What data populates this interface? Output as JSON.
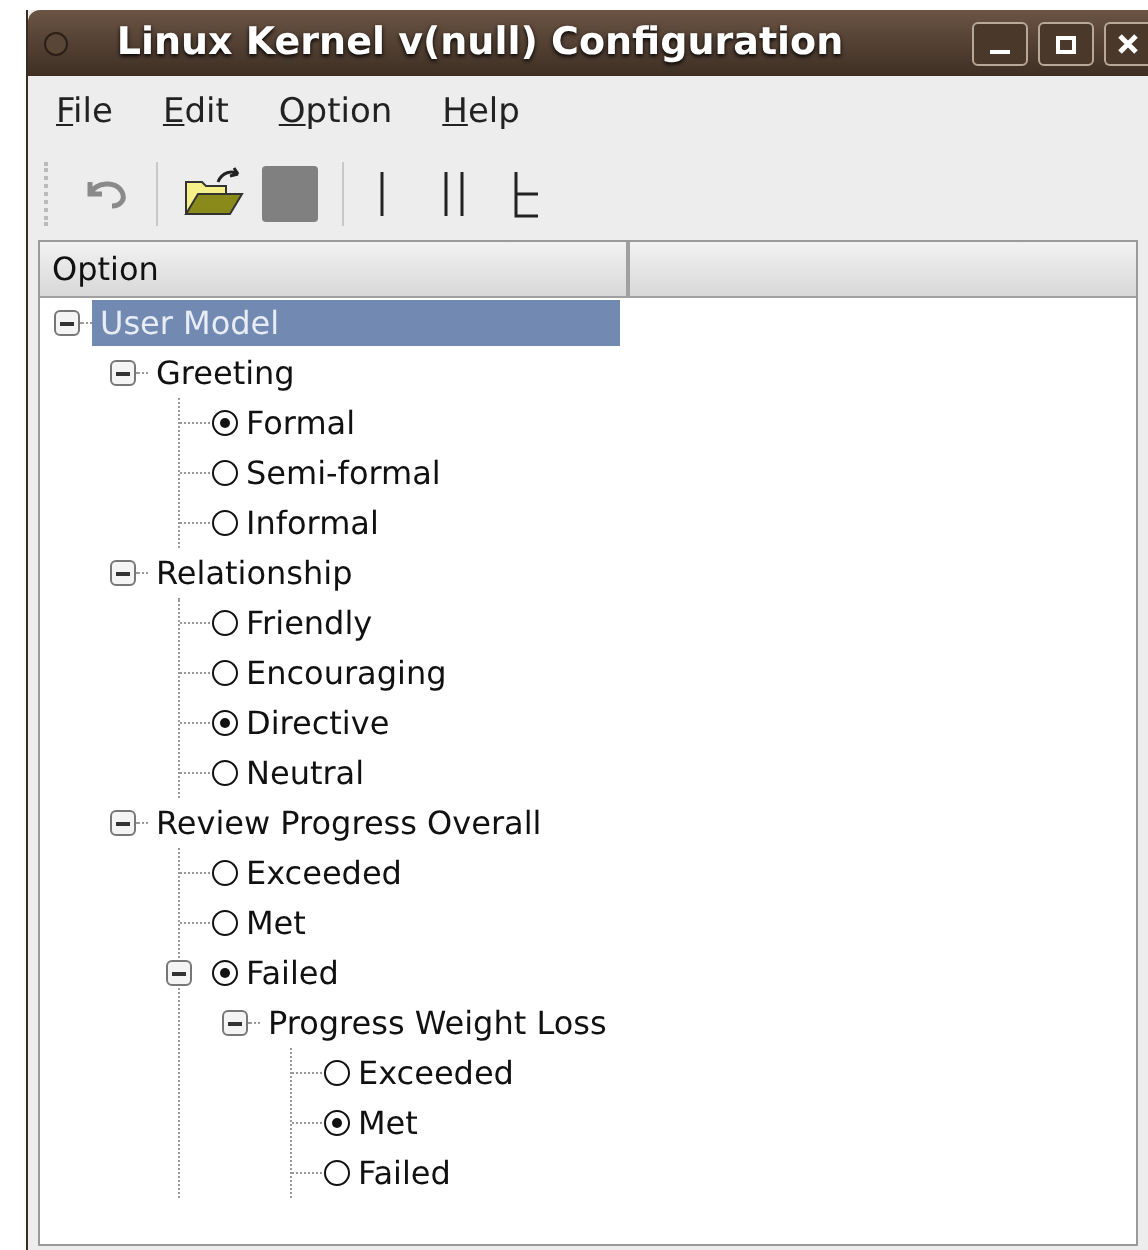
{
  "window": {
    "title": "Linux Kernel v(null) Configuration"
  },
  "menu": [
    "File",
    "Edit",
    "Option",
    "Help"
  ],
  "table": {
    "columns": [
      "Option"
    ]
  },
  "tree": [
    {
      "kind": "group",
      "label": "User Model",
      "selected": true,
      "expanded": true,
      "children": [
        {
          "kind": "group",
          "label": "Greeting",
          "selected": false,
          "expanded": true,
          "children": [
            {
              "kind": "option",
              "label": "Formal",
              "selected": false,
              "checked": true
            },
            {
              "kind": "option",
              "label": "Semi-formal",
              "selected": false,
              "checked": false
            },
            {
              "kind": "option",
              "label": "Informal",
              "selected": false,
              "checked": false
            }
          ]
        },
        {
          "kind": "group",
          "label": "Relationship",
          "selected": false,
          "expanded": true,
          "children": [
            {
              "kind": "option",
              "label": "Friendly",
              "selected": false,
              "checked": false
            },
            {
              "kind": "option",
              "label": "Encouraging",
              "selected": false,
              "checked": false
            },
            {
              "kind": "option",
              "label": "Directive",
              "selected": false,
              "checked": true
            },
            {
              "kind": "option",
              "label": "Neutral",
              "selected": false,
              "checked": false
            }
          ]
        },
        {
          "kind": "group",
          "label": "Review Progress Overall",
          "selected": false,
          "expanded": true,
          "children": [
            {
              "kind": "option",
              "label": "Exceeded",
              "selected": false,
              "checked": false
            },
            {
              "kind": "option",
              "label": "Met",
              "selected": false,
              "checked": false
            },
            {
              "kind": "option",
              "label": "Failed",
              "selected": false,
              "checked": true,
              "expanded": true,
              "children": [
                {
                  "kind": "group",
                  "label": "Progress Weight Loss",
                  "selected": false,
                  "expanded": true,
                  "children": [
                    {
                      "kind": "option",
                      "label": "Exceeded",
                      "selected": false,
                      "checked": false
                    },
                    {
                      "kind": "option",
                      "label": "Met",
                      "selected": false,
                      "checked": true
                    },
                    {
                      "kind": "option",
                      "label": "Failed",
                      "selected": false,
                      "checked": false
                    }
                  ]
                }
              ]
            }
          ]
        }
      ]
    }
  ]
}
